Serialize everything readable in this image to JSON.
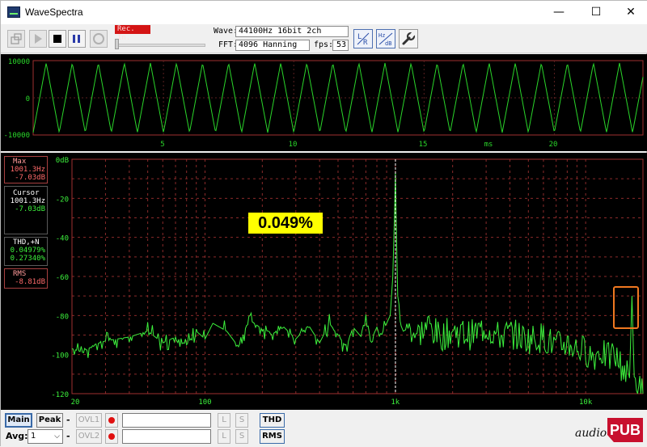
{
  "window": {
    "title": "WaveSpectra",
    "minimize": "—",
    "maximize": "☐",
    "close": "✕"
  },
  "toolbar": {
    "rec_in_label": "Rec. In.",
    "wave_label": "Wave:",
    "wave_value": "44100Hz 16bit 2ch",
    "fft_label": "FFT:",
    "fft_value": "4096 Hanning",
    "fps_label": "fps:",
    "fps_value": "53",
    "icons": [
      "wave-settings-icon",
      "play-icon",
      "stop-icon",
      "pause-icon",
      "record-icon",
      "lr-icon",
      "hz-db-icon",
      "wrench-icon"
    ]
  },
  "wave_chart": {
    "y_ticks": [
      "10000",
      "0",
      "-10000"
    ],
    "x_ticks": [
      "5",
      "10",
      "15",
      "20"
    ],
    "x_unit": "ms",
    "colors": {
      "trace": "#2ad62a",
      "frame": "#a03030",
      "grid": "#5a1e1e"
    }
  },
  "readouts": {
    "max": {
      "label": "Max",
      "freq": "1001.3Hz",
      "level": "-7.03dB"
    },
    "cursor": {
      "label": "Cursor",
      "freq": "1001.3Hz",
      "level": "-7.03dB"
    },
    "thd": {
      "label": "THD,+N",
      "thd": "0.04979%",
      "thdn": "0.27340%"
    },
    "rms": {
      "label": "RMS",
      "value": "-8.81dB"
    }
  },
  "annotation": {
    "thd_percent": "0.049%"
  },
  "chart_data": {
    "type": "line",
    "title": "",
    "xlabel": "",
    "ylabel": "",
    "x_scale": "log",
    "xlim": [
      20,
      20000
    ],
    "ylim": [
      -120,
      0
    ],
    "x_tick_labels": [
      "20",
      "100",
      "1k",
      "10k"
    ],
    "y_tick_labels": [
      "0dB",
      "-20",
      "-40",
      "-60",
      "-80",
      "-100",
      "-120"
    ],
    "grid": true,
    "series": [
      {
        "x": [
          20,
          23,
          26,
          30,
          40,
          50,
          60,
          70,
          80,
          90,
          100,
          110,
          130,
          150,
          170,
          200,
          230,
          260,
          300,
          350,
          400,
          450,
          500,
          550,
          600,
          650,
          700,
          750,
          800,
          850,
          900,
          940,
          970,
          990,
          1001,
          1010,
          1030,
          1060,
          1100,
          1200,
          1300,
          1500,
          1700,
          2000,
          2500,
          3000,
          3500,
          4000,
          5000,
          6000,
          7000,
          8000,
          9000,
          10000,
          11000,
          12000,
          13000,
          14000,
          15000,
          16000,
          17000,
          17500,
          18000,
          19000,
          20000
        ],
        "y": [
          -97,
          -99,
          -95,
          -93,
          -91,
          -88,
          -94,
          -91,
          -95,
          -88,
          -92,
          -84,
          -88,
          -96,
          -82,
          -87,
          -89,
          -86,
          -92,
          -85,
          -94,
          -84,
          -90,
          -96,
          -86,
          -90,
          -84,
          -92,
          -86,
          -88,
          -84,
          -80,
          -60,
          -28,
          -7,
          -30,
          -70,
          -84,
          -88,
          -86,
          -90,
          -85,
          -91,
          -88,
          -90,
          -86,
          -91,
          -89,
          -92,
          -91,
          -96,
          -94,
          -97,
          -98,
          -101,
          -98,
          -102,
          -100,
          -104,
          -108,
          -112,
          -70,
          -113,
          -116,
          -120
        ]
      }
    ],
    "colors": {
      "trace": "#3cf03c",
      "cursor": "#ffffff",
      "grid": "#8a2a2a",
      "frame": "#a03030",
      "axis_labels": "#3cf03c"
    }
  },
  "bottom": {
    "main": "Main",
    "peak": "Peak",
    "ovl1": "OVL1",
    "ovl2": "OVL2",
    "l": "L",
    "s": "S",
    "thd": "THD",
    "rms": "RMS",
    "avg_label": "Avg:",
    "avg_value": "1",
    "logo_text": "audio",
    "logo_badge": "PUB"
  }
}
